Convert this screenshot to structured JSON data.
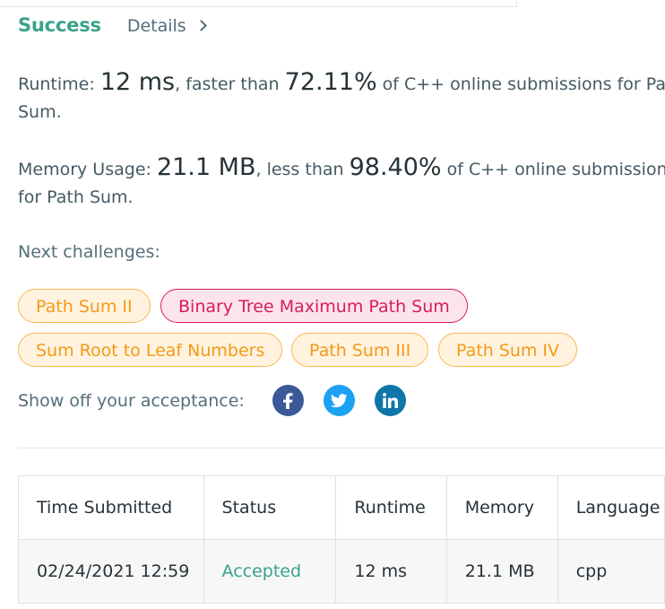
{
  "header": {
    "status": "Success",
    "details_link": "Details"
  },
  "runtime": {
    "label": "Runtime: ",
    "value": "12 ms",
    "mid": ", faster than ",
    "percent": "72.11%",
    "tail": " of C++ online submissions for Path Sum."
  },
  "memory": {
    "label": "Memory Usage: ",
    "value": "21.1 MB",
    "mid": ", less than ",
    "percent": "98.40%",
    "tail": " of C++ online submissions for Path Sum."
  },
  "next_challenges": {
    "label": "Next challenges:",
    "items": [
      {
        "label": "Path Sum II",
        "difficulty": "medium"
      },
      {
        "label": "Binary Tree Maximum Path Sum",
        "difficulty": "hard"
      },
      {
        "label": "Sum Root to Leaf Numbers",
        "difficulty": "medium"
      },
      {
        "label": "Path Sum III",
        "difficulty": "medium"
      },
      {
        "label": "Path Sum IV",
        "difficulty": "medium"
      }
    ]
  },
  "share": {
    "label": "Show off your acceptance:",
    "icons": [
      "facebook-icon",
      "twitter-icon",
      "linkedin-icon"
    ]
  },
  "submissions": {
    "columns": [
      "Time Submitted",
      "Status",
      "Runtime",
      "Memory",
      "Language"
    ],
    "rows": [
      {
        "time": "02/24/2021 12:59",
        "status": "Accepted",
        "runtime": "12 ms",
        "memory": "21.1 MB",
        "language": "cpp"
      }
    ]
  },
  "colors": {
    "success": "#3aa38a",
    "medium": "#f59a16",
    "hard": "#d81b60"
  }
}
